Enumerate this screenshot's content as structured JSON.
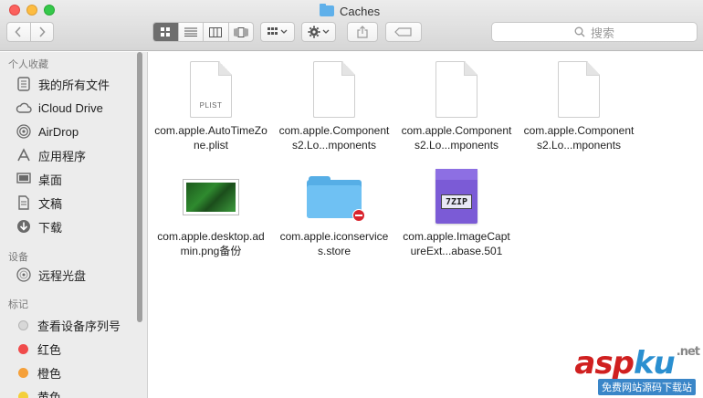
{
  "window": {
    "title": "Caches"
  },
  "toolbar": {
    "back_icon": "chevron-left-icon",
    "forward_icon": "chevron-right-icon",
    "view_modes": [
      "icon-view",
      "list-view",
      "column-view",
      "cover-flow-view"
    ],
    "arrange_icon": "grid-arrange-icon",
    "action_icon": "gear-icon",
    "share_icon": "share-icon",
    "tag_icon": "tag-icon",
    "search_placeholder": "搜索"
  },
  "sidebar": {
    "favorites_header": "个人收藏",
    "favorites": [
      {
        "label": "我的所有文件",
        "icon": "all-files-icon"
      },
      {
        "label": "iCloud Drive",
        "icon": "cloud-icon"
      },
      {
        "label": "AirDrop",
        "icon": "airdrop-icon"
      },
      {
        "label": "应用程序",
        "icon": "applications-icon"
      },
      {
        "label": "桌面",
        "icon": "desktop-icon"
      },
      {
        "label": "文稿",
        "icon": "document-icon"
      },
      {
        "label": "下载",
        "icon": "download-icon"
      }
    ],
    "devices_header": "设备",
    "devices": [
      {
        "label": "远程光盘",
        "icon": "disc-icon"
      }
    ],
    "tags_header": "标记",
    "tags": [
      {
        "label": "查看设备序列号",
        "color": "#d0d0d0"
      },
      {
        "label": "红色",
        "color": "#f04b4b"
      },
      {
        "label": "橙色",
        "color": "#f5a03a"
      },
      {
        "label": "黄色",
        "color": "#f4cf3a"
      }
    ]
  },
  "files": [
    {
      "name": "com.apple.AutoTimeZone.plist",
      "kind": "plist",
      "badge": "PLIST"
    },
    {
      "name": "com.apple.Components2.Lo...mponents",
      "kind": "doc"
    },
    {
      "name": "com.apple.Components2.Lo...mponents",
      "kind": "doc"
    },
    {
      "name": "com.apple.Components2.Lo...mponents",
      "kind": "doc"
    },
    {
      "name": "com.apple.desktop.admin.png备份",
      "kind": "image"
    },
    {
      "name": "com.apple.iconservices.store",
      "kind": "folder"
    },
    {
      "name": "com.apple.ImageCaptureExt...abase.501",
      "kind": "zip",
      "badge": "7ZIP"
    }
  ],
  "watermark": {
    "asp": "asp",
    "ku": "ku",
    "net": ".net",
    "sub": "免费网站源码下载站"
  }
}
